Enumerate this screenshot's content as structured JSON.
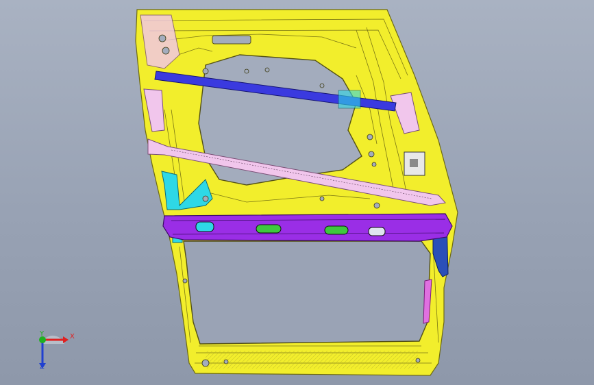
{
  "viewport": {
    "background_top": "#a9b2c2",
    "background_bottom": "#8e98aa"
  },
  "model": {
    "parts": [
      {
        "name": "inner-door-panel",
        "color": "#f2ee2c"
      },
      {
        "name": "beltline-reinforcement",
        "color": "#9a2ee6"
      },
      {
        "name": "glass-run-rail",
        "color": "#3a3adf"
      },
      {
        "name": "diagonal-brace",
        "color": "#f1c6ec"
      },
      {
        "name": "hinge-bracket",
        "color": "#2ed8e6"
      },
      {
        "name": "latch-channel",
        "color": "#2a4fb8"
      }
    ]
  },
  "triad": {
    "x_label": "X",
    "y_label": "Y",
    "z_label": "Z",
    "x_color": "#e02020",
    "y_color": "#20b020",
    "z_color": "#2040d0"
  }
}
